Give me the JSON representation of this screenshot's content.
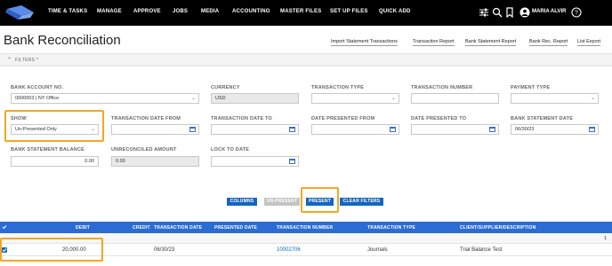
{
  "nav": {
    "items": [
      "TIME & TASKS",
      "MANAGE",
      "APPROVE",
      "JOBS",
      "MEDIA",
      "ACCOUNTING",
      "MASTER FILES",
      "SET UP FILES",
      "QUICK ADD"
    ],
    "user": "MARIA ALVIR",
    "icons": [
      "sliders-icon",
      "search-icon",
      "bookmark-icon",
      "help-icon",
      "user-icon"
    ]
  },
  "page": {
    "title": "Bank Reconciliation",
    "links": [
      "Import Statement Transactions",
      "Transaction Report",
      "Bank Statement Report",
      "Bank Rec. Report",
      "List Export"
    ]
  },
  "filters": {
    "label": "FILTERS *",
    "bank_account": {
      "label": "BANK ACCOUNT NO.",
      "value": "0000003 | NY Office"
    },
    "currency": {
      "label": "CURRENCY",
      "value": "USD"
    },
    "transaction_type": {
      "label": "TRANSACTION TYPE",
      "value": ""
    },
    "transaction_number": {
      "label": "TRANSACTION NUMBER",
      "value": ""
    },
    "payment_type": {
      "label": "PAYMENT TYPE",
      "value": ""
    },
    "show": {
      "label": "SHOW",
      "value": "Un-Presented Only"
    },
    "date_from": {
      "label": "TRANSACTION DATE FROM",
      "value": ""
    },
    "date_to": {
      "label": "TRANSACTION DATE TO",
      "value": ""
    },
    "presented_from": {
      "label": "DATE PRESENTED FROM",
      "value": ""
    },
    "presented_to": {
      "label": "DATE PRESENTED TO",
      "value": ""
    },
    "statement_date": {
      "label": "BANK STATEMENT DATE",
      "value": "06/30/23"
    },
    "statement_balance": {
      "label": "BANK STATEMENT BALANCE",
      "value": "0.00"
    },
    "unreconciled": {
      "label": "UNRECONCILED AMOUNT",
      "value": "0.00"
    },
    "lock_to_date": {
      "label": "LOCK TO DATE",
      "value": ""
    }
  },
  "buttons": {
    "columns": "COLUMNS",
    "unpresent": "UN-PRESENT",
    "present": "PRESENT",
    "clear_filters": "CLEAR FILTERS"
  },
  "table": {
    "headers": {
      "debit": "DEBIT",
      "credit": "CREDIT",
      "transaction_date": "TRANSACTION DATE",
      "presented_date": "PRESENTED DATE",
      "transaction_number": "TRANSACTION NUMBER",
      "transaction_type": "TRANSACTION TYPE",
      "client": "CLIENT/SUPPLIER/DESCRIPTION"
    },
    "group_count": "1",
    "rows": [
      {
        "debit": "20,000.00",
        "credit": "",
        "transaction_date": "06/30/23",
        "presented_date": "",
        "transaction_number": "10002706",
        "transaction_type": "Journals",
        "client": "Trial Balance Test"
      }
    ]
  },
  "colors": {
    "nav_bg": "#000000",
    "accent": "#1565c0",
    "header_bg": "#2b6cd4",
    "highlight": "#f5a623"
  }
}
